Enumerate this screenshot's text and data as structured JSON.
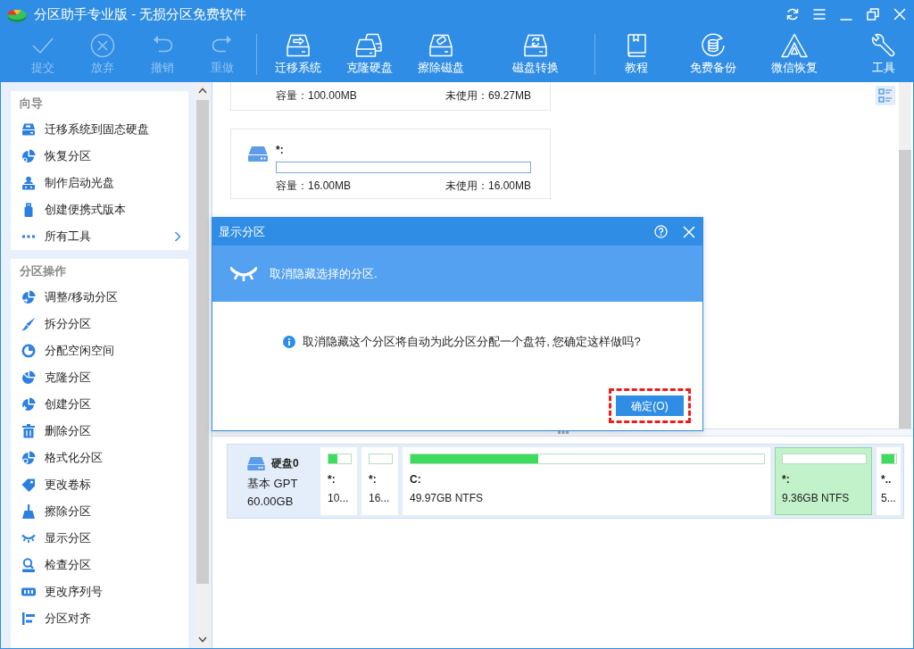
{
  "window": {
    "title": "分区助手专业版 - 无损分区免费软件"
  },
  "toolbar": {
    "groups": [
      {
        "items": [
          {
            "label": "提交",
            "disabled": true
          },
          {
            "label": "放弃",
            "disabled": true
          },
          {
            "label": "撤销",
            "disabled": true
          },
          {
            "label": "重做",
            "disabled": true
          }
        ]
      },
      {
        "items": [
          {
            "label": "迁移系统",
            "disabled": false
          },
          {
            "label": "克隆硬盘",
            "disabled": false
          },
          {
            "label": "擦除磁盘",
            "disabled": false
          },
          {
            "label": "磁盘转换",
            "disabled": false
          }
        ]
      },
      {
        "items": [
          {
            "label": "教程",
            "disabled": false
          },
          {
            "label": "免费备份",
            "disabled": false
          },
          {
            "label": "微信恢复",
            "disabled": false
          },
          {
            "label": "工具",
            "disabled": false
          }
        ]
      }
    ]
  },
  "sidebar": {
    "sections": [
      {
        "title": "向导",
        "items": [
          {
            "label": "迁移系统到固态硬盘",
            "kind": "action"
          },
          {
            "label": "恢复分区",
            "kind": "action"
          },
          {
            "label": "制作启动光盘",
            "kind": "action"
          },
          {
            "label": "创建便携式版本",
            "kind": "action"
          },
          {
            "label": "所有工具",
            "kind": "submenu"
          }
        ]
      },
      {
        "title": "分区操作",
        "items": [
          {
            "label": "调整/移动分区",
            "kind": "action"
          },
          {
            "label": "拆分分区",
            "kind": "action"
          },
          {
            "label": "分配空闲空间",
            "kind": "action"
          },
          {
            "label": "克隆分区",
            "kind": "action"
          },
          {
            "label": "创建分区",
            "kind": "action"
          },
          {
            "label": "删除分区",
            "kind": "action"
          },
          {
            "label": "格式化分区",
            "kind": "action"
          },
          {
            "label": "更改卷标",
            "kind": "action"
          },
          {
            "label": "擦除分区",
            "kind": "action"
          },
          {
            "label": "显示分区",
            "kind": "action"
          },
          {
            "label": "检查分区",
            "kind": "action"
          },
          {
            "label": "更改序列号",
            "kind": "action"
          },
          {
            "label": "分区对齐",
            "kind": "action"
          }
        ]
      }
    ]
  },
  "partition_list": [
    {
      "capacity": "容量：100.00MB",
      "unused": "未使用：69.27MB"
    },
    {
      "label": "*:",
      "level": 0,
      "capacity": "容量：16.00MB",
      "unused": "未使用：16.00MB"
    }
  ],
  "disk_map": {
    "disk": {
      "name": "硬盘0",
      "type": "基本 GPT",
      "size": "60.00GB"
    },
    "partitions": [
      {
        "label": "*:",
        "info": "10...",
        "level": 0.4,
        "selected": false
      },
      {
        "label": "*:",
        "info": "16...",
        "level": 0,
        "selected": false
      },
      {
        "label": "C:",
        "info": "49.97GB NTFS",
        "level": 0.36,
        "selected": false
      },
      {
        "label": "*:",
        "info": "9.36GB NTFS",
        "level": 0,
        "selected": true
      },
      {
        "label": "*..",
        "info": "5...",
        "level": 0.85,
        "selected": false
      }
    ]
  },
  "dialog": {
    "title": "显示分区",
    "banner": "取消隐藏选择的分区.",
    "message": "取消隐藏这个分区将自动为此分区分配一个盘符, 您确定这样做吗?",
    "button": {
      "label": "确定(O)",
      "highlighted": true
    }
  }
}
